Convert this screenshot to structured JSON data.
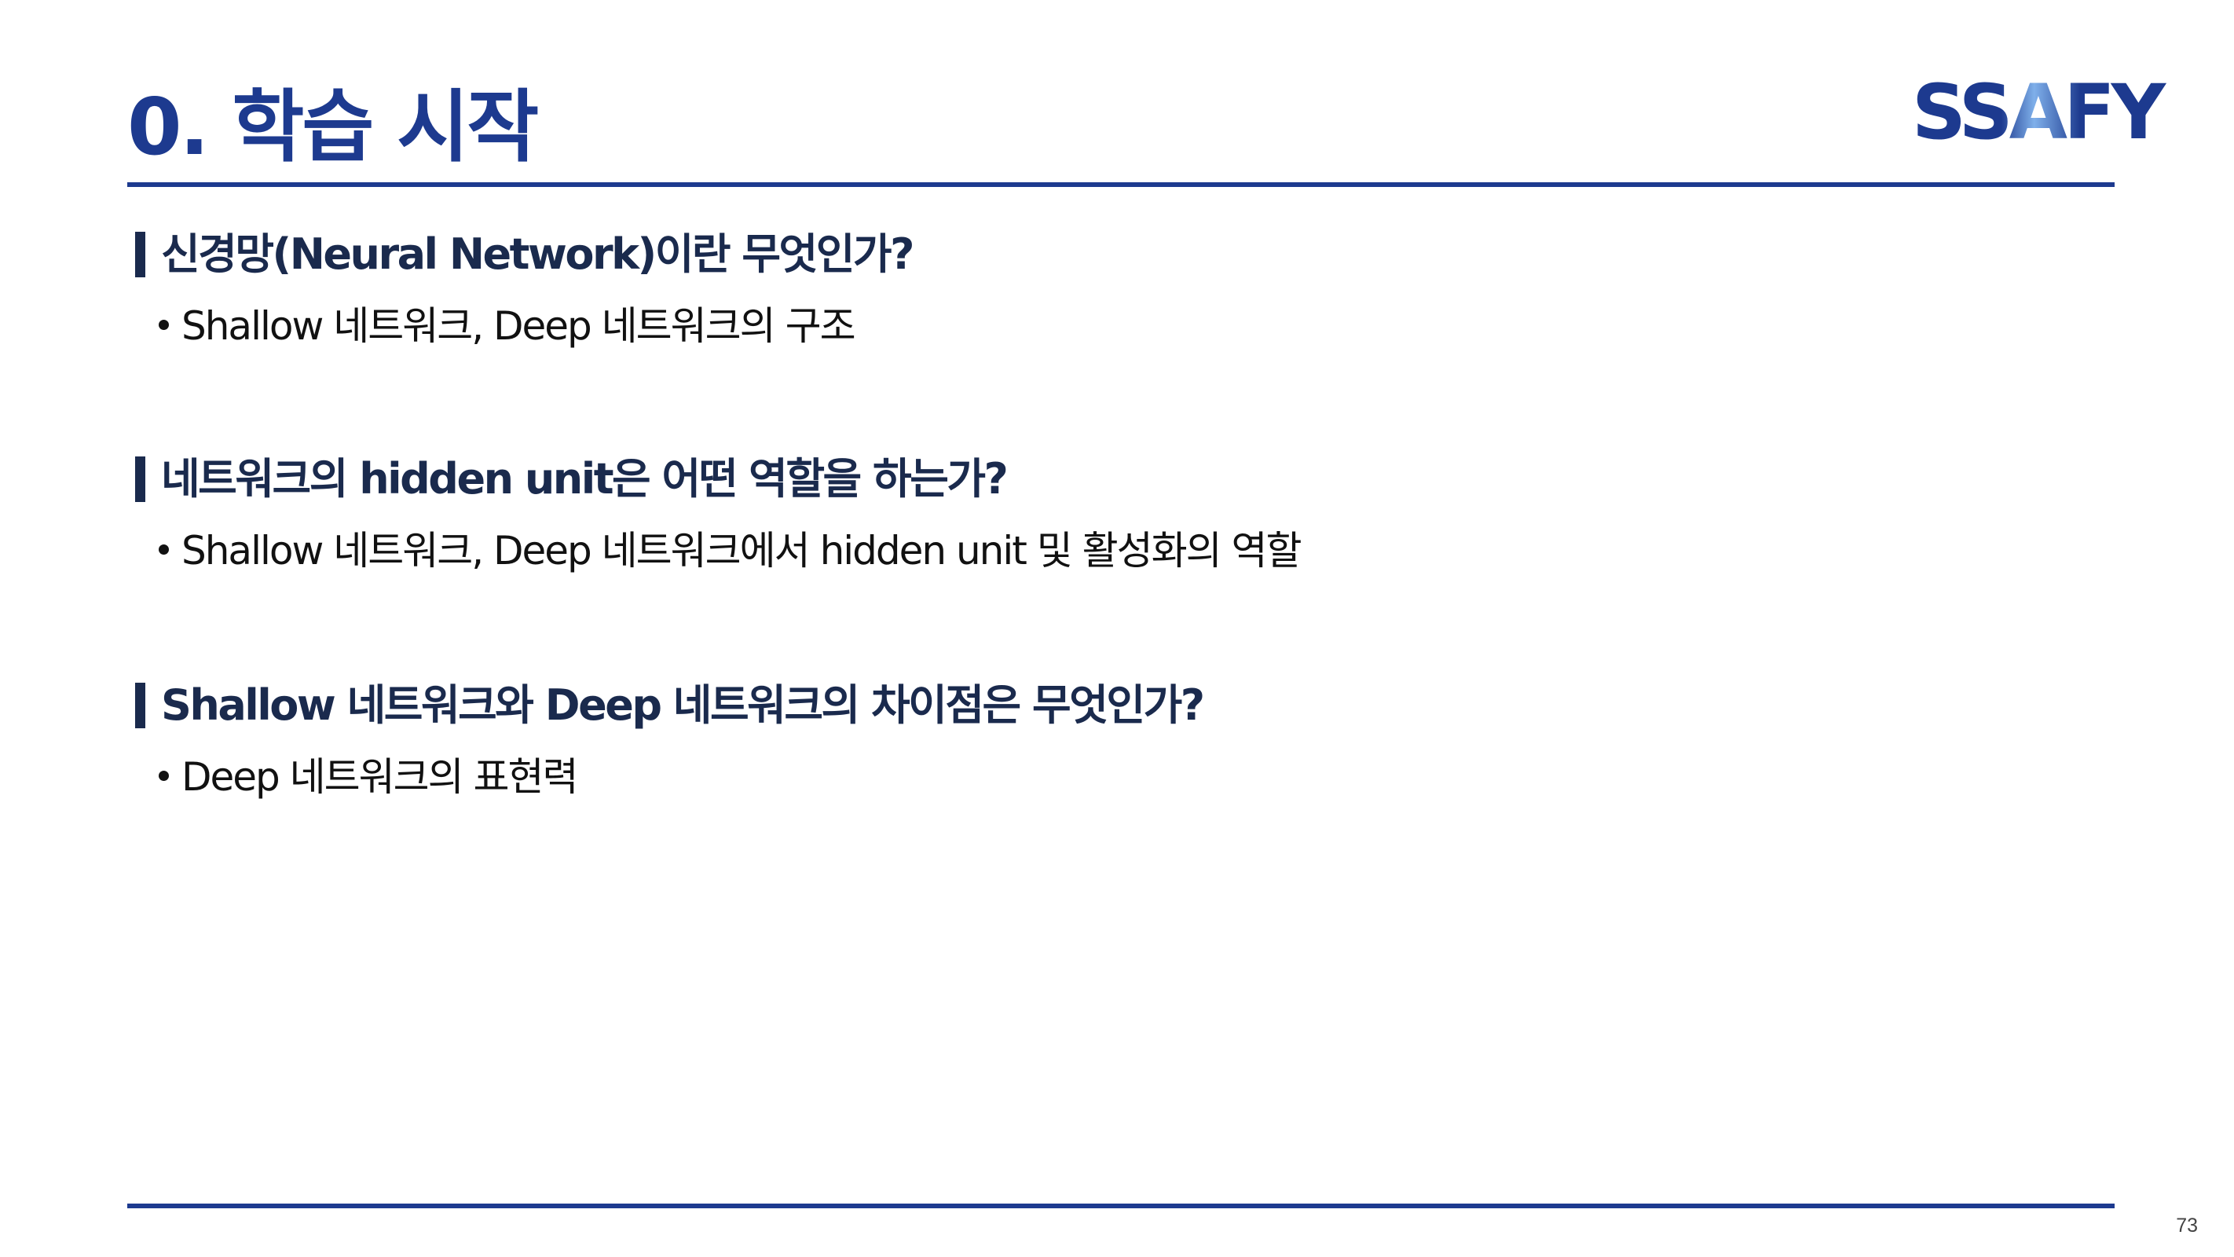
{
  "slide": {
    "title": "0. 학습 시작",
    "logo_text": "SSAFY",
    "page_number": "73"
  },
  "sections": [
    {
      "heading": "신경망(Neural Network)이란 무엇인가?",
      "bullet": "Shallow 네트워크, Deep 네트워크의 구조"
    },
    {
      "heading": "네트워크의 hidden unit은 어떤 역할을 하는가?",
      "bullet": "Shallow 네트워크, Deep 네트워크에서 hidden unit 및 활성화의 역할"
    },
    {
      "heading": "Shallow 네트워크와 Deep 네트워크의 차이점은 무엇인가?",
      "bullet": "Deep 네트워크의 표현력"
    }
  ],
  "colors": {
    "accent": "#1d3a8f",
    "heading": "#1a2a4d",
    "logo_light": "#7fb0ea"
  }
}
